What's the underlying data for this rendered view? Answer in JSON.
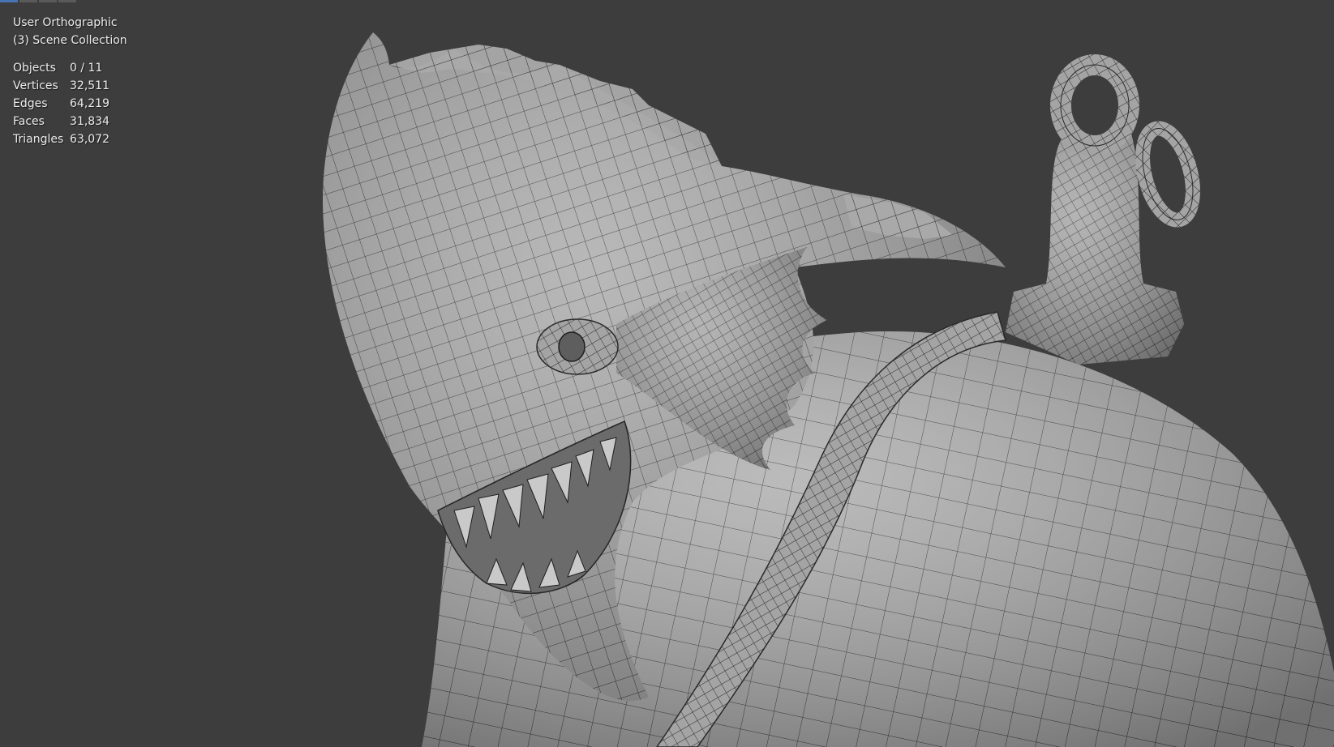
{
  "viewport": {
    "view_name": "User Orthographic",
    "collection": "(3) Scene Collection",
    "background_color": "#3d3d3d",
    "mesh_color": "#a9a9a9",
    "wire_color": "#2a2a2a"
  },
  "stats": [
    {
      "label": "Objects",
      "value": "0 / 11"
    },
    {
      "label": "Vertices",
      "value": "32,511"
    },
    {
      "label": "Edges",
      "value": "64,219"
    },
    {
      "label": "Faces",
      "value": "31,834"
    },
    {
      "label": "Triangles",
      "value": "63,072"
    }
  ]
}
